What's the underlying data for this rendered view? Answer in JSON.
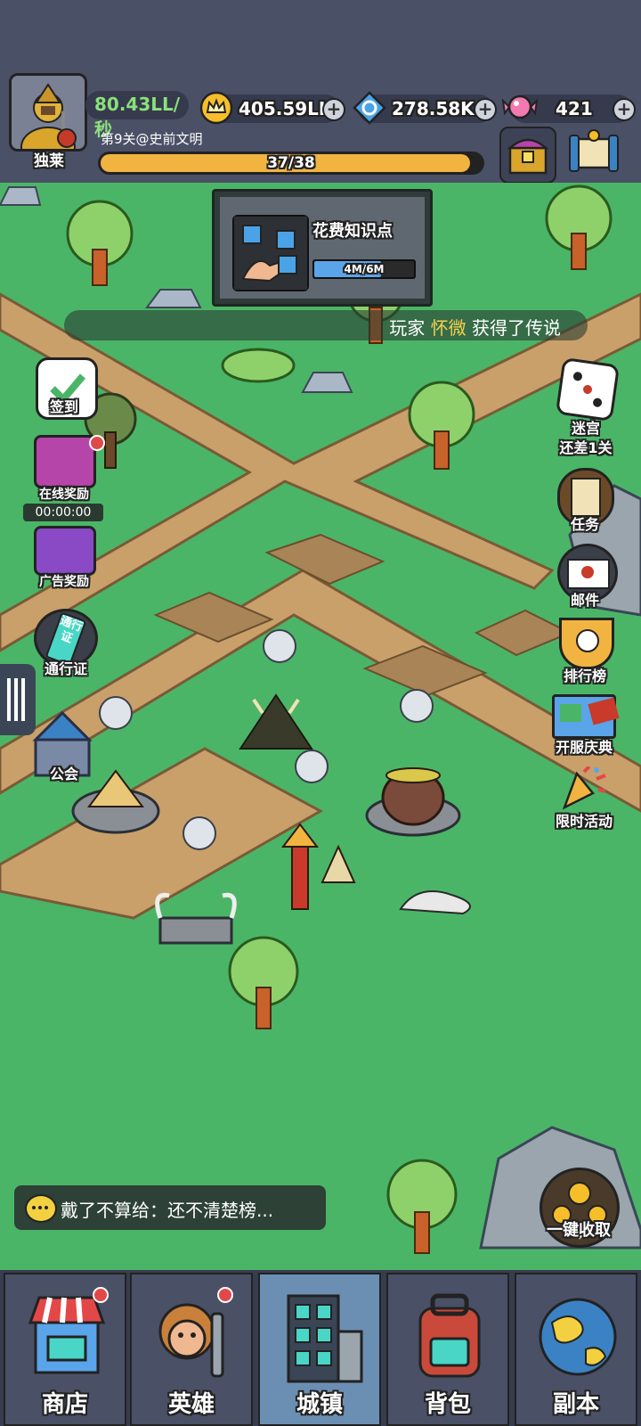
{
  "player": {
    "name": "独莱",
    "income": "80.43LL/秒",
    "stage": "第9关@史前文明",
    "progress_text": "37/38",
    "progress": 0.97
  },
  "currencies": [
    {
      "name": "crown-coin-icon",
      "value": "405.59LL"
    },
    {
      "name": "blue-gem-icon",
      "value": "278.58K"
    },
    {
      "name": "candy-icon",
      "value": "421"
    }
  ],
  "task": {
    "title": "花费知识点",
    "progress_text": "4M/6M",
    "progress": 0.67
  },
  "ticker": {
    "prefix": "玩家",
    "player": "怀微",
    "suffix": "获得了传说"
  },
  "left_buttons": {
    "signin": "签到",
    "online_reward": "在线奖励",
    "online_timer": "00:00:00",
    "ad_reward": "广告奖励",
    "pass_badge": "通行证",
    "pass": "通行证",
    "guild": "公会"
  },
  "right_buttons": {
    "maze": "迷宫",
    "maze_sub": "还差1关",
    "tasks": "任务",
    "mail": "邮件",
    "rank": "排行榜",
    "celebration": "开服庆典",
    "event": "限时活动"
  },
  "chat": {
    "text": "戴了不算给：还不清楚榜..."
  },
  "collect": {
    "label": "一键收取"
  },
  "nav": [
    {
      "label": "商店",
      "icon": "shop-icon",
      "badge": true
    },
    {
      "label": "英雄",
      "icon": "caveman-hero-icon",
      "badge": true
    },
    {
      "label": "城镇",
      "icon": "town-building-icon",
      "badge": false,
      "active": true
    },
    {
      "label": "背包",
      "icon": "backpack-icon",
      "badge": false
    },
    {
      "label": "副本",
      "icon": "globe-icon",
      "badge": false
    }
  ],
  "colors": {
    "accent_yellow": "#f2b440",
    "income_green": "#8be07a",
    "ticker_highlight": "#f5d250",
    "map_green": "#4bb567",
    "path_brown": "#c9a06a"
  }
}
